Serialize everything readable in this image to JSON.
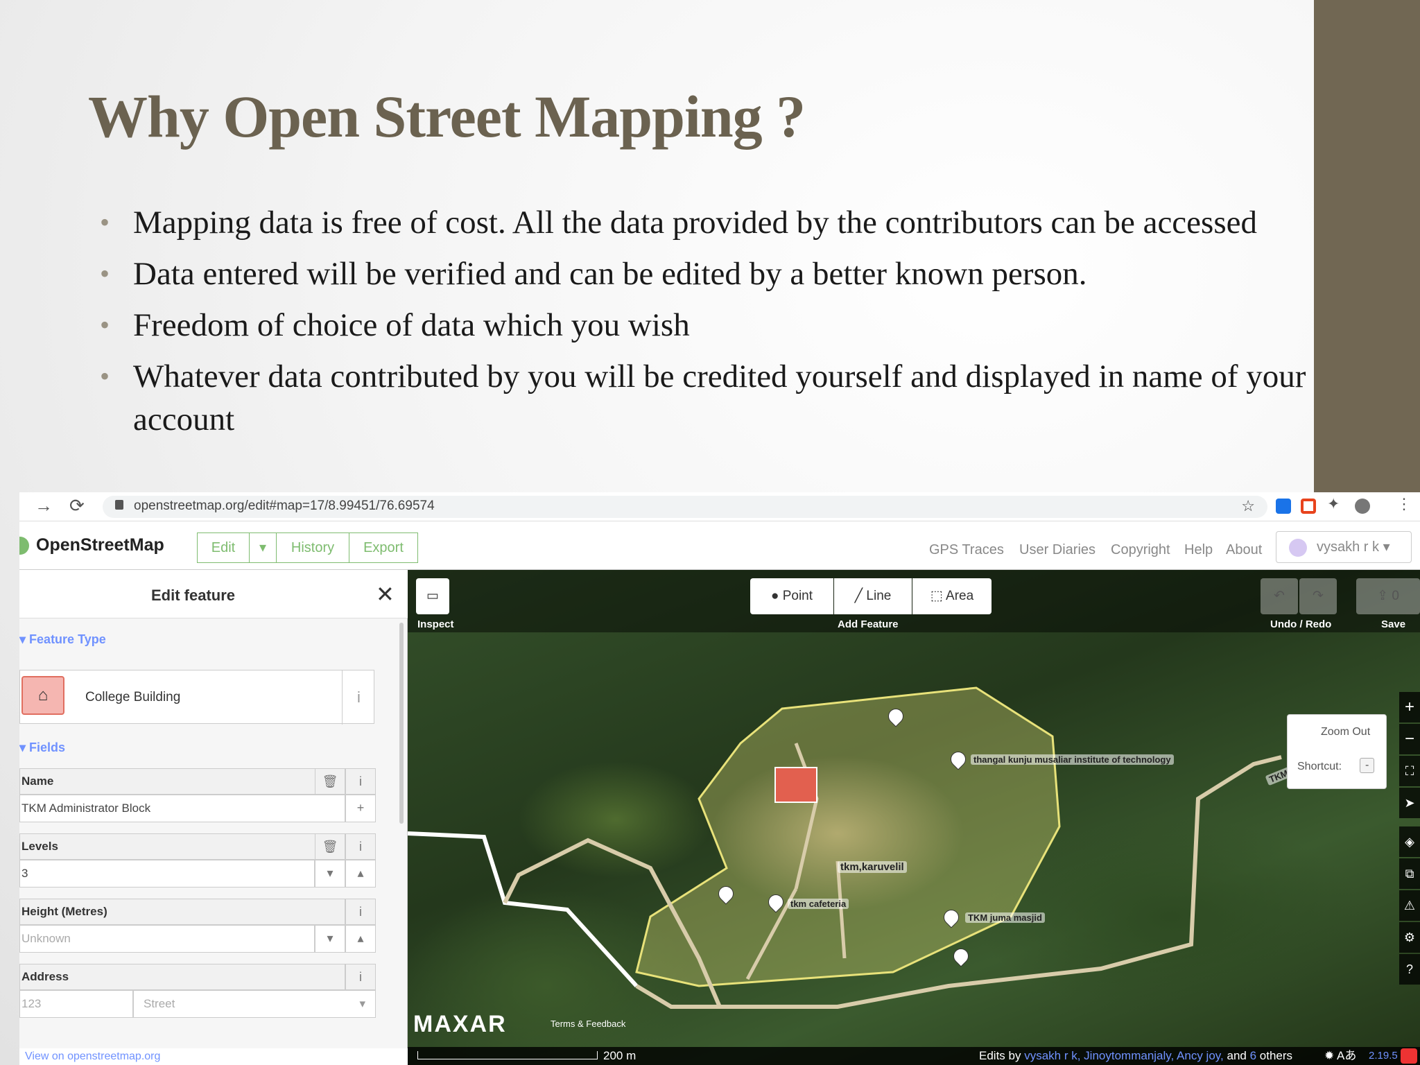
{
  "slide": {
    "title": "Why Open Street Mapping ?",
    "bullets": [
      "Mapping data is free of cost. All the data provided by the contributors can be accessed",
      " Data entered will be verified and can be edited by a better known person.",
      "Freedom of choice of data which you wish",
      "Whatever data contributed by you will be credited yourself and displayed in name of your account"
    ],
    "bullet_char": "•"
  },
  "browser": {
    "url": "openstreetmap.org/edit#map=17/8.99451/76.69574"
  },
  "osm": {
    "brand": "OpenStreetMap",
    "buttons": {
      "edit": "Edit",
      "history": "History",
      "export": "Export"
    },
    "nav": [
      "GPS Traces",
      "User Diaries",
      "Copyright",
      "Help",
      "About"
    ],
    "user": "vysakh r k"
  },
  "editor": {
    "title": "Edit feature",
    "feature_type_heading": "Feature Type",
    "feature_type": "College Building",
    "fields_heading": "Fields",
    "fields": [
      {
        "label": "Name",
        "value": "TKM Administrator Block"
      },
      {
        "label": "Levels",
        "value": "3"
      },
      {
        "label": "Height (Metres)",
        "placeholder": "Unknown"
      },
      {
        "label": "Address",
        "placeholder_number": "123",
        "placeholder_street": "Street"
      }
    ],
    "footer_link": "View on openstreetmap.org"
  },
  "map": {
    "toolbar": {
      "inspect_label": "Inspect",
      "point": "Point",
      "line": "Line",
      "area": "Area",
      "add_feature_label": "Add Feature",
      "undo_redo_label": "Undo / Redo",
      "save_label": "Save",
      "save_count": "0"
    },
    "zoom_tooltip": {
      "title": "Zoom Out",
      "shortcut_label": "Shortcut:",
      "shortcut_key": "-"
    },
    "labels": {
      "institute": "thangal kunju musaliar institute of technology",
      "karuvelil": "tkm,karuvelil",
      "cafeteria": "tkm cafeteria",
      "masjid": "TKM juma masjid",
      "road": "TKM"
    },
    "imagery_brand": "MAXAR",
    "terms": "Terms & Feedback",
    "scale": "200 m",
    "credits_prefix": "Edits by",
    "credit_users": "vysakh r k, Jinoytommanjaly, Ancy joy,",
    "credits_and": "and",
    "credits_others_count": "6",
    "credits_others": "others",
    "version": "2.19.5"
  }
}
